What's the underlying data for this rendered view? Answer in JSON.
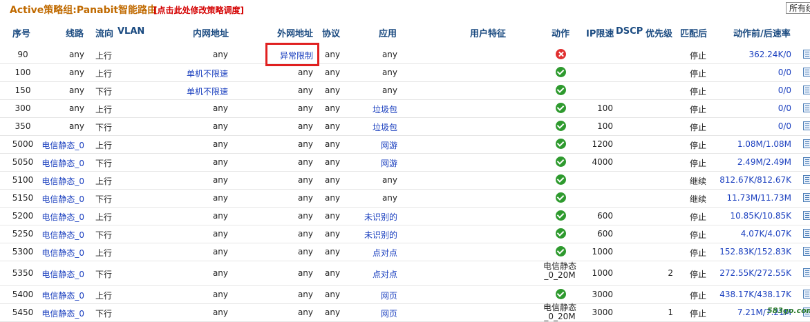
{
  "title": "Active策略组:Panabit智能路由",
  "title_link": "[点击此处修改策略调度]",
  "filter_value": "所有线",
  "headers": [
    "序号",
    "线路",
    "流向",
    "VLAN",
    "内网地址",
    "外网地址",
    "协议",
    "应用",
    "用户特征",
    "动作",
    "IP限速",
    "DSCP",
    "优先级",
    "匹配后",
    "动作前/后速率"
  ],
  "rows": [
    {
      "id": "90",
      "line": "any",
      "dir": "上行",
      "inner": "any",
      "outer": "异常限制",
      "proto": "any",
      "app": "any",
      "action": "err",
      "iplimit": "",
      "prio": "",
      "after": "停止",
      "rate": "362.24K/0"
    },
    {
      "id": "100",
      "line": "any",
      "dir": "上行",
      "inner": "单机不限速",
      "outer": "any",
      "proto": "any",
      "app": "any",
      "action": "ok",
      "iplimit": "",
      "prio": "",
      "after": "停止",
      "rate": "0/0"
    },
    {
      "id": "150",
      "line": "any",
      "dir": "下行",
      "inner": "单机不限速",
      "outer": "any",
      "proto": "any",
      "app": "any",
      "action": "ok",
      "iplimit": "",
      "prio": "",
      "after": "停止",
      "rate": "0/0"
    },
    {
      "id": "300",
      "line": "any",
      "dir": "上行",
      "inner": "any",
      "outer": "any",
      "proto": "any",
      "app": "垃圾包",
      "action": "ok",
      "iplimit": "100",
      "prio": "",
      "after": "停止",
      "rate": "0/0"
    },
    {
      "id": "350",
      "line": "any",
      "dir": "下行",
      "inner": "any",
      "outer": "any",
      "proto": "any",
      "app": "垃圾包",
      "action": "ok",
      "iplimit": "100",
      "prio": "",
      "after": "停止",
      "rate": "0/0"
    },
    {
      "id": "5000",
      "line": "电信静态_0",
      "dir": "上行",
      "inner": "any",
      "outer": "any",
      "proto": "any",
      "app": "网游",
      "action": "ok",
      "iplimit": "1200",
      "prio": "",
      "after": "停止",
      "rate": "1.08M/1.08M"
    },
    {
      "id": "5050",
      "line": "电信静态_0",
      "dir": "下行",
      "inner": "any",
      "outer": "any",
      "proto": "any",
      "app": "网游",
      "action": "ok",
      "iplimit": "4000",
      "prio": "",
      "after": "停止",
      "rate": "2.49M/2.49M"
    },
    {
      "id": "5100",
      "line": "电信静态_0",
      "dir": "上行",
      "inner": "any",
      "outer": "any",
      "proto": "any",
      "app": "any",
      "action": "ok",
      "iplimit": "",
      "prio": "",
      "after": "继续",
      "rate": "812.67K/812.67K"
    },
    {
      "id": "5150",
      "line": "电信静态_0",
      "dir": "下行",
      "inner": "any",
      "outer": "any",
      "proto": "any",
      "app": "any",
      "action": "ok",
      "iplimit": "",
      "prio": "",
      "after": "继续",
      "rate": "11.73M/11.73M"
    },
    {
      "id": "5200",
      "line": "电信静态_0",
      "dir": "上行",
      "inner": "any",
      "outer": "any",
      "proto": "any",
      "app": "未识别的",
      "action": "ok",
      "iplimit": "600",
      "prio": "",
      "after": "停止",
      "rate": "10.85K/10.85K"
    },
    {
      "id": "5250",
      "line": "电信静态_0",
      "dir": "下行",
      "inner": "any",
      "outer": "any",
      "proto": "any",
      "app": "未识别的",
      "action": "ok",
      "iplimit": "600",
      "prio": "",
      "after": "停止",
      "rate": "4.07K/4.07K"
    },
    {
      "id": "5300",
      "line": "电信静态_0",
      "dir": "上行",
      "inner": "any",
      "outer": "any",
      "proto": "any",
      "app": "点对点",
      "action": "ok",
      "iplimit": "1000",
      "prio": "",
      "after": "停止",
      "rate": "152.83K/152.83K"
    },
    {
      "id": "5350",
      "line": "电信静态_0",
      "dir": "下行",
      "inner": "any",
      "outer": "any",
      "proto": "any",
      "app": "点对点",
      "action": "text",
      "action_text": "电信静态_0_20M",
      "iplimit": "1000",
      "prio": "2",
      "after": "停止",
      "rate": "272.55K/272.55K"
    },
    {
      "id": "5400",
      "line": "电信静态_0",
      "dir": "上行",
      "inner": "any",
      "outer": "any",
      "proto": "any",
      "app": "网页",
      "action": "ok",
      "iplimit": "3000",
      "prio": "",
      "after": "停止",
      "rate": "438.17K/438.17K"
    },
    {
      "id": "5450",
      "line": "电信静态_0",
      "dir": "下行",
      "inner": "any",
      "outer": "any",
      "proto": "any",
      "app": "网页",
      "action": "text",
      "action_text": "电信静态_0_20M",
      "iplimit": "3000",
      "prio": "1",
      "after": "停止",
      "rate": "7.21M/7.21M"
    }
  ],
  "watermark": "583go.com"
}
